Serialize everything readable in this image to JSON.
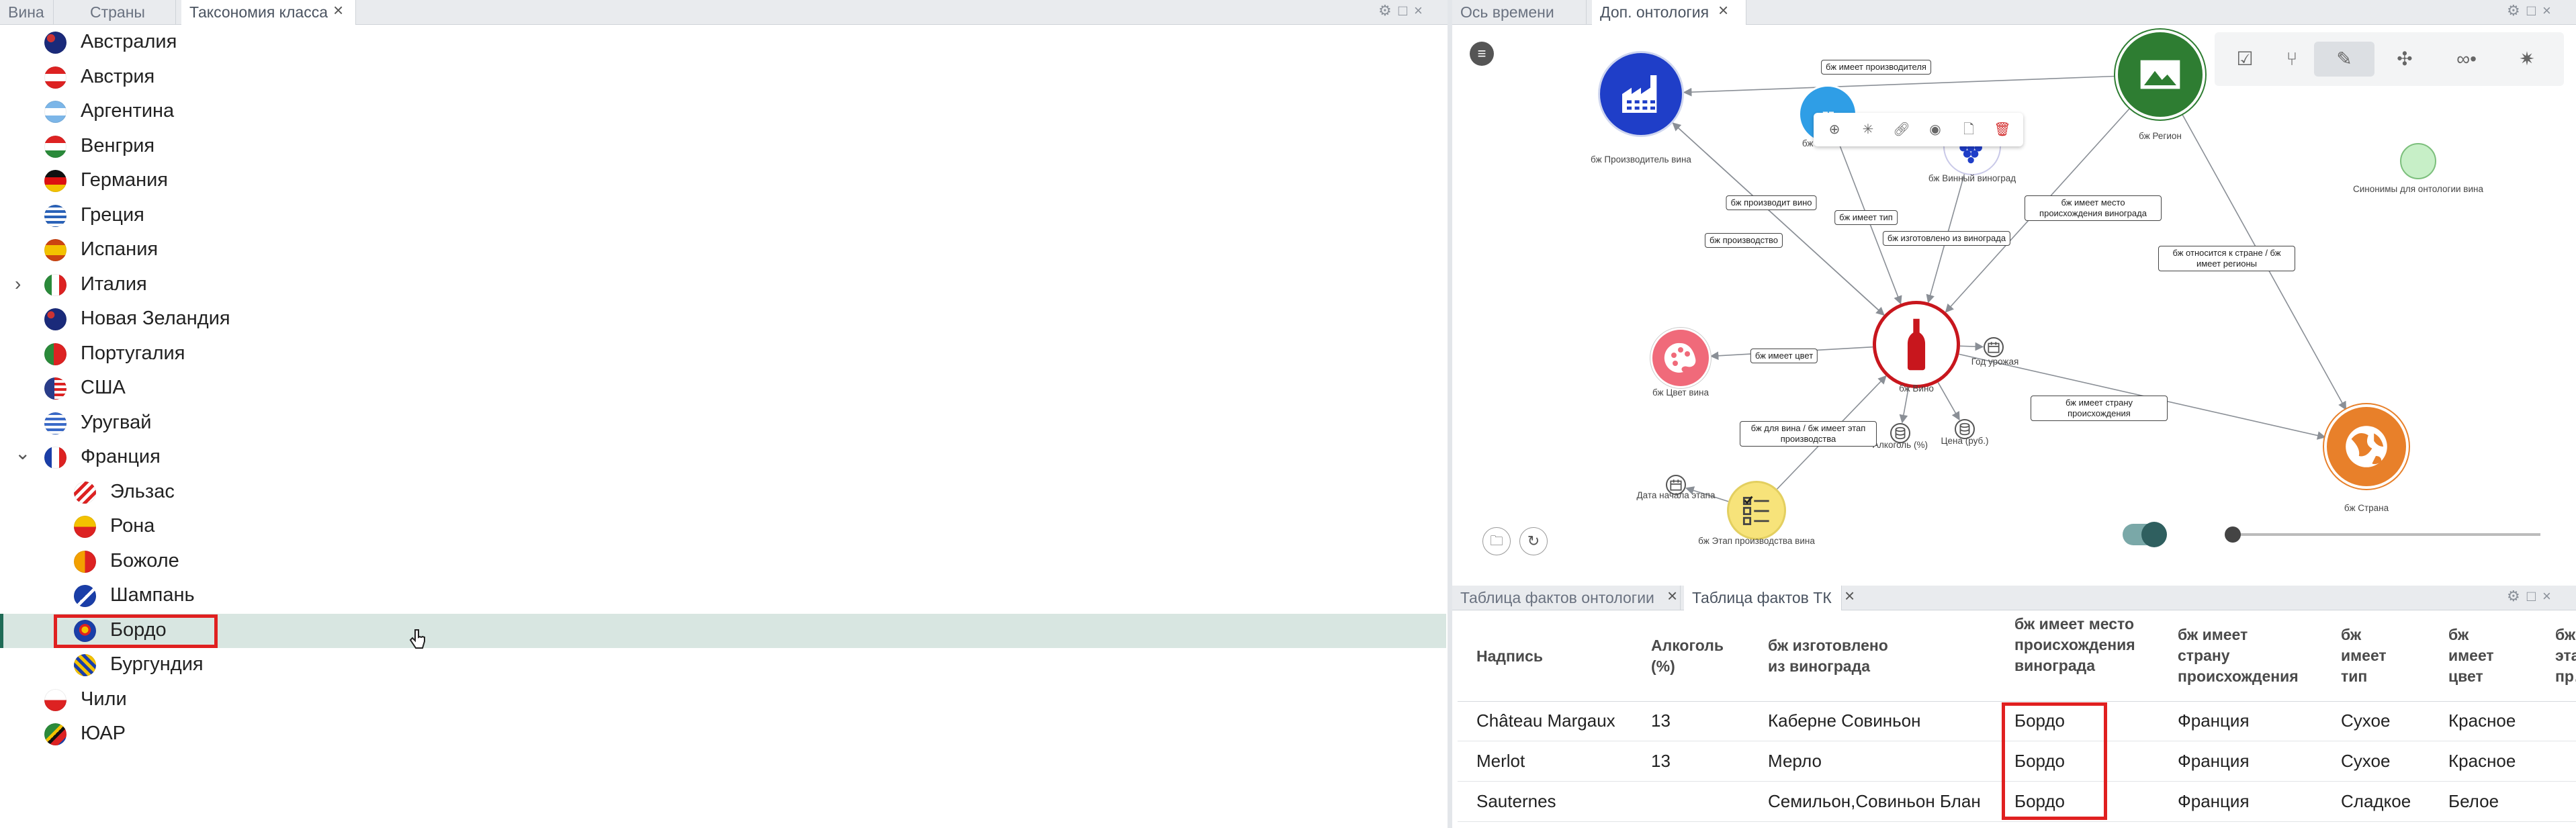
{
  "left_panel": {
    "tabs": [
      {
        "label": "Вина"
      },
      {
        "label": "Страны"
      },
      {
        "label": "Таксономия класса"
      }
    ],
    "tree": [
      {
        "label": "Австралия",
        "flag": "au"
      },
      {
        "label": "Австрия",
        "flag": "at"
      },
      {
        "label": "Аргентина",
        "flag": "ar"
      },
      {
        "label": "Венгрия",
        "flag": "hu"
      },
      {
        "label": "Германия",
        "flag": "de"
      },
      {
        "label": "Греция",
        "flag": "gr"
      },
      {
        "label": "Испания",
        "flag": "es"
      },
      {
        "label": "Италия",
        "flag": "it",
        "collapsed": true
      },
      {
        "label": "Новая Зеландия",
        "flag": "nz"
      },
      {
        "label": "Португалия",
        "flag": "pt"
      },
      {
        "label": "США",
        "flag": "us"
      },
      {
        "label": "Уругвай",
        "flag": "uy"
      },
      {
        "label": "Франция",
        "flag": "fr",
        "expanded": true
      },
      {
        "label": "Эльзас",
        "flag": "alsace",
        "child": true
      },
      {
        "label": "Рона",
        "flag": "rhone",
        "child": true
      },
      {
        "label": "Божоле",
        "flag": "beaujolais",
        "child": true
      },
      {
        "label": "Шампань",
        "flag": "champagne",
        "child": true
      },
      {
        "label": "Бордо",
        "flag": "bordeaux",
        "child": true,
        "selected": true
      },
      {
        "label": "Бургундия",
        "flag": "burgundy",
        "child": true
      },
      {
        "label": "Чили",
        "flag": "cl"
      },
      {
        "label": "ЮАР",
        "flag": "za"
      }
    ]
  },
  "right_top_panel": {
    "tabs": [
      {
        "label": "Ось времени"
      },
      {
        "label": "Доп. онтология"
      }
    ],
    "graph": {
      "nodes": [
        {
          "id": "producer",
          "label": "бж Производитель вина",
          "icon": "factory-icon"
        },
        {
          "id": "winetype",
          "label": "бж Тип вина",
          "icon": "ship-icon"
        },
        {
          "id": "grape",
          "label": "бж Винный виноград",
          "icon": "grape-icon"
        },
        {
          "id": "region",
          "label": "бж Регион",
          "icon": "landscape-icon"
        },
        {
          "id": "synonyms",
          "label": "Синонимы для онтологии вина",
          "icon": "circle-icon"
        },
        {
          "id": "color",
          "label": "бж Цвет вина",
          "icon": "palette-icon"
        },
        {
          "id": "wine",
          "label": "бж Вино",
          "icon": "wine-bottle-icon"
        },
        {
          "id": "harvest",
          "label": "Год урожая",
          "icon": "calendar-icon"
        },
        {
          "id": "alcohol",
          "label": "Алкоголь (%)",
          "icon": "database-icon"
        },
        {
          "id": "price",
          "label": "Цена (руб.)",
          "icon": "database-icon"
        },
        {
          "id": "stagedate",
          "label": "Дата начала этапа",
          "icon": "calendar-icon"
        },
        {
          "id": "stage",
          "label": "бж Этап производства вина",
          "icon": "checklist-icon"
        },
        {
          "id": "country",
          "label": "бж Страна",
          "icon": "globe-icon"
        }
      ],
      "edge_labels": [
        "бж имеет производителя",
        "бж производит вино",
        "бж производство",
        "бж имеет тип",
        "бж изготовлено из винограда",
        "бж имеет место происхождения винограда",
        "бж относится к стране / бж имеет регионы",
        "бж имеет цвет",
        "бж для вина / бж имеет этап производства",
        "бж имеет страну происхождения"
      ],
      "node_toolbar": [
        "add-icon",
        "expand-icon",
        "link-icon",
        "target-icon",
        "document-icon",
        "delete-icon"
      ]
    },
    "tools": [
      "checklist-icon",
      "graph-add-icon",
      "pencil-icon",
      "move-icon",
      "glasses-icon",
      "layout-icon"
    ],
    "slider_value": 0.0,
    "toggle_on": true
  },
  "right_bottom_panel": {
    "tabs": [
      {
        "label": "Таблица фактов онтологии"
      },
      {
        "label": "Таблица фактов ТК"
      }
    ],
    "table": {
      "headers": [
        "Надпись",
        "Алкоголь (%)",
        "бж изготовлено из винограда",
        "бж имеет место происхождения винограда",
        "бж имеет страну происхождения",
        "бж имеет тип",
        "бж имеет цвет",
        "бж эта… пр…"
      ],
      "rows": [
        [
          "Château Margaux",
          "13",
          "Каберне Совиньон",
          "Бордо",
          "Франция",
          "Сухое",
          "Красное"
        ],
        [
          "Merlot",
          "13",
          "Мерло",
          "Бордо",
          "Франция",
          "Сухое",
          "Красное"
        ],
        [
          "Sauternes",
          "",
          "Семильон,Совиньон Блан",
          "Бордо",
          "Франция",
          "Сладкое",
          "Белое"
        ]
      ]
    }
  },
  "colors": {
    "accent_green": "#2e7d32",
    "selection_red": "#e02020",
    "wine_red": "#c8161d",
    "factory_blue": "#1f3ec8"
  }
}
